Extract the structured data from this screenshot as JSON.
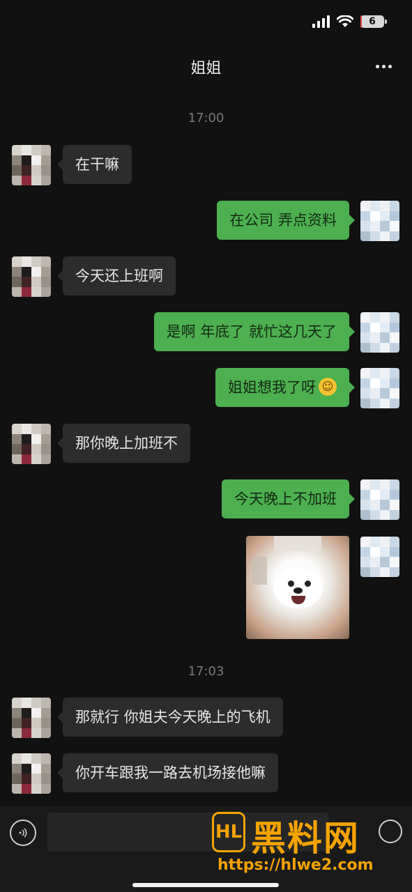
{
  "status_bar": {
    "battery": "6",
    "battery_level": 0.06
  },
  "header": {
    "title": "姐姐"
  },
  "messages": {
    "ts1": "17:00",
    "m1": "在干嘛",
    "m2": "在公司 弄点资料",
    "m3": "今天还上班啊",
    "m4": "是啊 年底了 就忙这几天了",
    "m5": "姐姐想我了呀",
    "m6": "那你晚上加班不",
    "m7": "今天晚上不加班",
    "ts2": "17:03",
    "m8": "那就行 你姐夫今天晚上的飞机",
    "m9": "你开车跟我一路去机场接他嘛"
  },
  "watermark": {
    "logo": "HL",
    "title": "黑料网",
    "url": "https://hlwe2.com"
  },
  "colors": {
    "outgoing_bubble": "#4caf50",
    "incoming_bubble": "#2c2c2c",
    "background": "#111111",
    "watermark": "#f5a300"
  },
  "icons": [
    "signal-icon",
    "wifi-icon",
    "battery-icon",
    "more-icon",
    "voice-icon",
    "emoji-icon"
  ]
}
